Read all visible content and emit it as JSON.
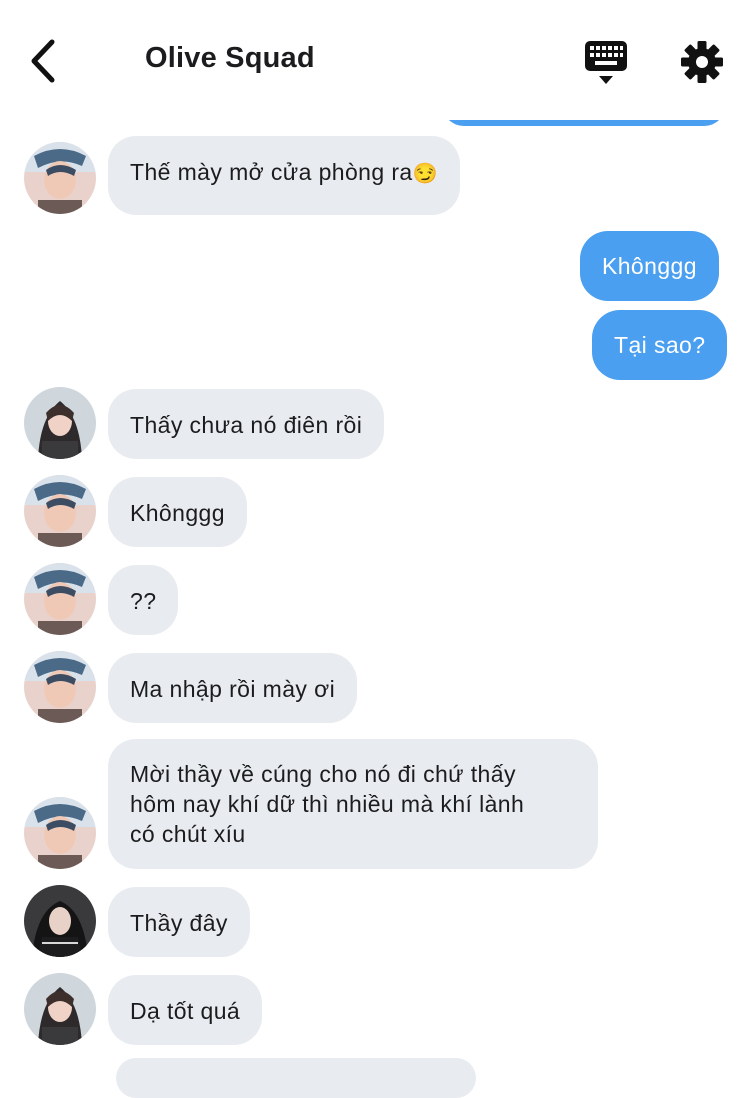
{
  "header": {
    "title": "Olive Squad"
  },
  "icons": {
    "back": "chevron-left-icon",
    "keyboard": "keyboard-icon",
    "settings": "gear-icon"
  },
  "colors": {
    "outgoing_bubble": "#4a9ff0",
    "incoming_bubble": "#e8ebef",
    "text_dark": "#1c1c1e"
  },
  "messages": [
    {
      "id": "m1",
      "direction": "in",
      "sender": "user-a",
      "text": "Thế mày mở cửa phòng ra",
      "emoji": "😏"
    },
    {
      "id": "m2",
      "direction": "out",
      "text": "Khônggg"
    },
    {
      "id": "m3",
      "direction": "out",
      "text": "Tại sao?"
    },
    {
      "id": "m4",
      "direction": "in",
      "sender": "user-b",
      "text": "Thấy chưa nó điên rồi"
    },
    {
      "id": "m5",
      "direction": "in",
      "sender": "user-a",
      "text": "Khônggg"
    },
    {
      "id": "m6",
      "direction": "in",
      "sender": "user-a",
      "text": "??"
    },
    {
      "id": "m7",
      "direction": "in",
      "sender": "user-a",
      "text": "Ma nhập rồi mày ơi"
    },
    {
      "id": "m8",
      "direction": "in",
      "sender": "user-a",
      "lines": [
        "Mời thầy về cúng cho nó đi chứ thấy",
        "hôm nay khí dữ thì nhiều mà khí lành",
        "có chút xíu"
      ]
    },
    {
      "id": "m9",
      "direction": "in",
      "sender": "user-c",
      "text": "Thầy đây"
    },
    {
      "id": "m10",
      "direction": "in",
      "sender": "user-b",
      "text": "Dạ tốt quá"
    }
  ]
}
